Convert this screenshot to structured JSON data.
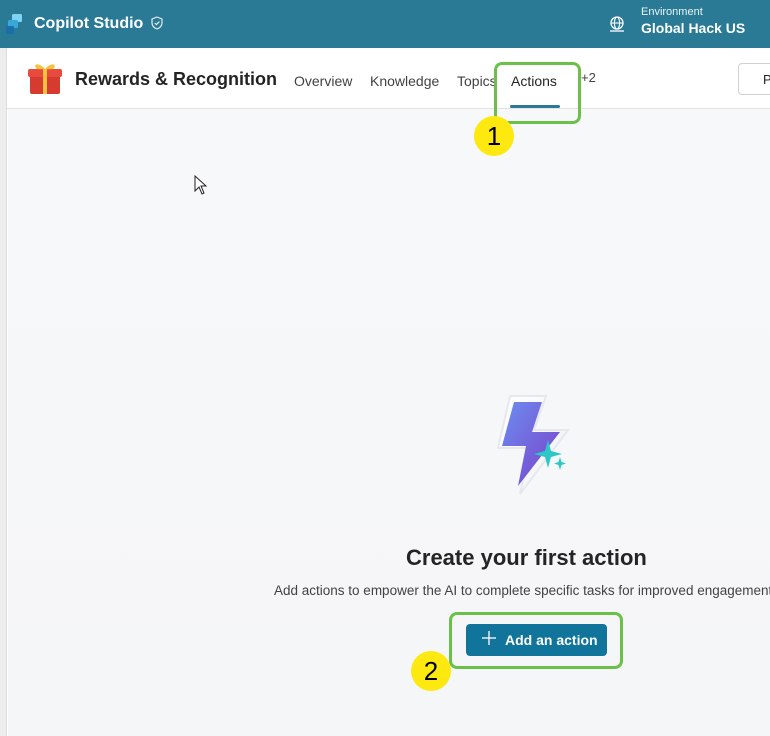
{
  "topbar": {
    "app_title": "Copilot Studio",
    "environment_label": "Environment",
    "environment_value": "Global Hack US",
    "background": "#2a7a96"
  },
  "header": {
    "agent_name": "Rewards & Recognition",
    "tabs": [
      {
        "label": "Overview",
        "active": false
      },
      {
        "label": "Knowledge",
        "active": false
      },
      {
        "label": "Topics",
        "active": false
      },
      {
        "label": "Actions",
        "active": true
      }
    ],
    "more_tabs": "+2",
    "publish_label": "P"
  },
  "empty_state": {
    "title": "Create your first action",
    "description": "Add actions to empower the AI to complete specific tasks for improved engagement",
    "button_label": "Add an action",
    "button_color": "#11749b"
  },
  "annotations": {
    "step_1": "1",
    "step_2": "2",
    "highlight_color": "#6cc04a",
    "badge_color": "#fde910"
  }
}
